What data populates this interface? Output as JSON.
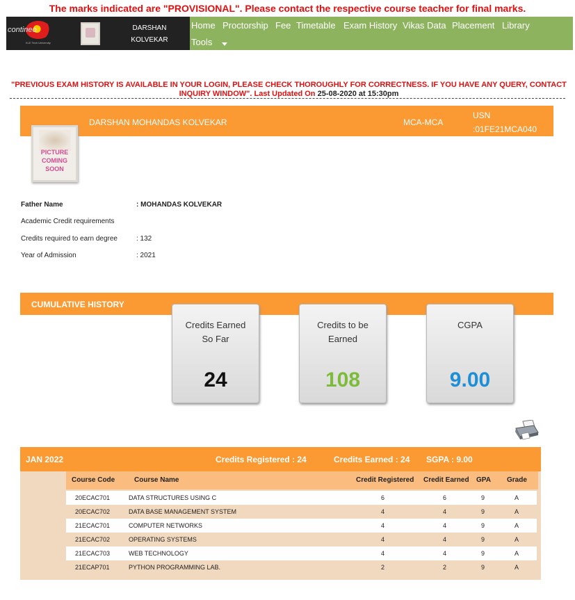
{
  "banner": {
    "provisional": "The marks indicated are \"PROVISIONAL\". Please contact the respective course teacher for final marks."
  },
  "brand": {
    "logo_word": "contineo",
    "logo_sub": "KLE Tech University",
    "student_first": "DARSHAN",
    "student_last": "KOLVEKAR"
  },
  "nav": {
    "items": [
      "Home",
      "Proctorship",
      "Fee",
      "Timetable",
      "Exam History",
      "Vikas Data",
      "Placement",
      "Library"
    ],
    "tools": "Tools"
  },
  "notice": {
    "text": "\"PREVIOUS EXAM HISTORY IS AVAILABLE IN YOUR LOGIN, PLEASE CHECK THOROUGHLY FOR CORRECTNESS. IF YOU HAVE ANY QUERY, CONTACT INQUIRY WINDOW\". Last Updated On",
    "updated": "25-08-2020 at 15:30pm"
  },
  "profile": {
    "name": "DARSHAN MOHANDAS KOLVEKAR",
    "course": "MCA-MCA",
    "usn_label": "USN",
    "usn": ":01FE21MCA040",
    "photo_text": [
      "PICTURE",
      "COMING",
      "SOON"
    ]
  },
  "info": {
    "father_label": "Father Name",
    "father_value": ":  MOHANDAS KOLVEKAR",
    "credit_req_label": "Academic Credit requirements",
    "credits_label": "Credits required to earn degree",
    "credits_value": ":  132",
    "admission_label": "Year of Admission",
    "admission_value": ":  2021"
  },
  "cumulative": {
    "title": "CUMULATIVE HISTORY",
    "cards": [
      {
        "label_line1": "Credits Earned",
        "label_line2": "So Far",
        "value": "24",
        "color": "#111111"
      },
      {
        "label_line1": "Credits to be",
        "label_line2": "Earned",
        "value": "108",
        "color": "#7dbb3a"
      },
      {
        "label_line1": "CGPA",
        "label_line2": "",
        "value": "9.00",
        "color": "#1d8fd6"
      }
    ]
  },
  "semester": {
    "term": "JAN 2022",
    "credits_registered": "Credits Registered : 24",
    "credits_earned": "Credits Earned : 24",
    "sgpa": "SGPA : 9.00",
    "headers": [
      "Course Code",
      "Course Name",
      "Credit Registered",
      "Credit Earned",
      "GPA",
      "Grade"
    ],
    "rows": [
      [
        "20ECAC701",
        "DATA STRUCTURES USING C",
        "6",
        "6",
        "9",
        "A"
      ],
      [
        "20ECAC702",
        "DATA BASE MANAGEMENT SYSTEM",
        "4",
        "4",
        "9",
        "A"
      ],
      [
        "21ECAC701",
        "COMPUTER NETWORKS",
        "4",
        "4",
        "9",
        "A"
      ],
      [
        "21ECAC702",
        "OPERATING SYSTEMS",
        "4",
        "4",
        "9",
        "A"
      ],
      [
        "21ECAC703",
        "WEB TECHNOLOGY",
        "4",
        "4",
        "9",
        "A"
      ],
      [
        "21ECAP701",
        "PYTHON PROGRAMMING LAB.",
        "2",
        "2",
        "9",
        "A"
      ]
    ]
  }
}
